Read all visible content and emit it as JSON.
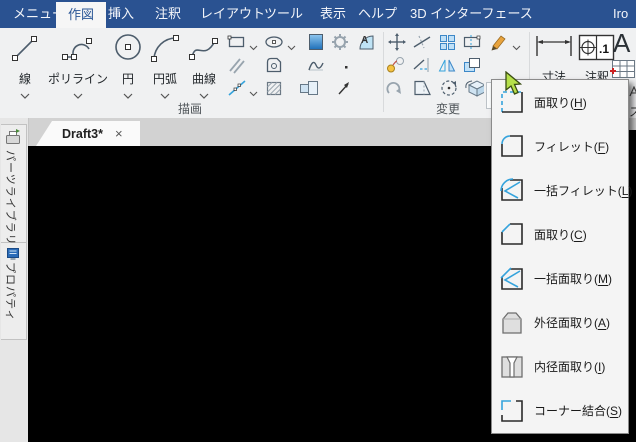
{
  "menubar": {
    "tabs": [
      "メニュー",
      "作図",
      "挿入",
      "注釈",
      "レイアウト",
      "ツール",
      "表示",
      "ヘルプ",
      "3D インターフェース"
    ],
    "active_tab": "作図",
    "overflow_tab": "Iro"
  },
  "ribbon": {
    "draw_group": {
      "label": "描画",
      "big_tools": [
        "線",
        "ポリライン",
        "円",
        "円弧",
        "曲線"
      ],
      "small_tools": [
        "rectangle",
        "ellipse",
        "hatch",
        "block",
        "area",
        "offset",
        "region",
        "curve",
        "point",
        "construction-line",
        "hatch-region",
        "solid",
        "pointer"
      ]
    },
    "modify_group": {
      "label": "変更",
      "tools": [
        "move",
        "trim",
        "pattern",
        "stretch",
        "edit-annotation",
        "copy",
        "extend",
        "mirror",
        "offset-entities",
        "chamfer-tools",
        "undo-curve",
        "taper",
        "rotate",
        "rotate-3d"
      ]
    },
    "dimension_tool": "寸法",
    "annotation_tool": "注釈",
    "text_tool_glyph": "A",
    "clipped_right_text": "ス"
  },
  "tabbar": {
    "document_tab": {
      "title": "Draft3*",
      "close_glyph": "×"
    }
  },
  "sidebar": {
    "tabs": [
      "パーツライブラリ",
      "プロパティ"
    ]
  },
  "dropdown": {
    "paren_open": "(",
    "paren_close": ")",
    "items": [
      {
        "text": "面取り",
        "key": "H",
        "icon": "chamfer-dashed-icon"
      },
      {
        "text": "フィレット",
        "key": "F",
        "icon": "fillet-icon"
      },
      {
        "text": "一括フィレット",
        "key": "L",
        "icon": "multi-fillet-icon"
      },
      {
        "text": "面取り",
        "key": "C",
        "icon": "chamfer-line-icon"
      },
      {
        "text": "一括面取り",
        "key": "M",
        "icon": "multi-chamfer-icon"
      },
      {
        "text": "外径面取り",
        "key": "A",
        "icon": "outer-chamfer-icon"
      },
      {
        "text": "内径面取り",
        "key": "I",
        "icon": "inner-chamfer-icon"
      },
      {
        "text": "コーナー結合",
        "key": "S",
        "icon": "corner-join-icon"
      }
    ]
  },
  "colors": {
    "menubar_bg": "#2a5291",
    "active_tab_text": "#2b5797",
    "ribbon_bg": "#f0f1f2",
    "accent_blue": "#35a3dc",
    "canvas_bg": "#000000",
    "cursor_green": "#b6e04a",
    "pencil_orange": "#e8a33d",
    "copy_yellow": "#f5c242"
  }
}
